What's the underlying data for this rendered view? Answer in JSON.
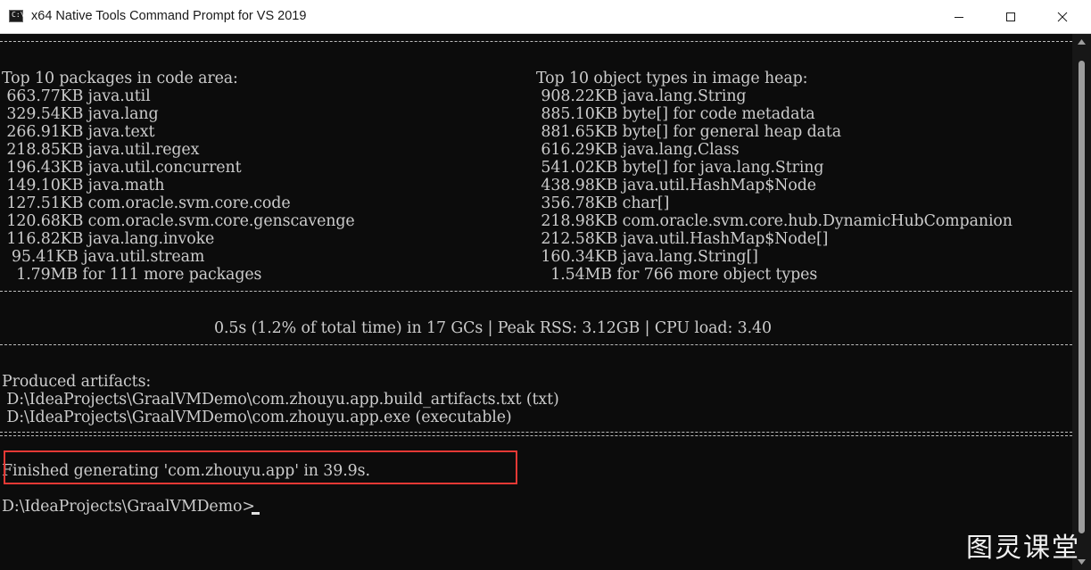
{
  "window": {
    "title": "x64 Native Tools Command Prompt for VS 2019",
    "icon": "cmd-icon",
    "controls": [
      "minimize-icon",
      "maximize-icon",
      "close-icon"
    ]
  },
  "terminal": {
    "left_header": "Top 10 packages in code area:",
    "right_header": "Top 10 object types in image heap:",
    "packages": [
      " 663.77KB java.util",
      " 329.54KB java.lang",
      " 266.91KB java.text",
      " 218.85KB java.util.regex",
      " 196.43KB java.util.concurrent",
      " 149.10KB java.math",
      " 127.51KB com.oracle.svm.core.code",
      " 120.68KB com.oracle.svm.core.genscavenge",
      " 116.82KB java.lang.invoke",
      "  95.41KB java.util.stream",
      "   1.79MB for 111 more packages"
    ],
    "object_types": [
      " 908.22KB java.lang.String",
      " 885.10KB byte[] for code metadata",
      " 881.65KB byte[] for general heap data",
      " 616.29KB java.lang.Class",
      " 541.02KB byte[] for java.lang.String",
      " 438.98KB java.util.HashMap$Node",
      " 356.78KB char[]",
      " 218.98KB com.oracle.svm.core.hub.DynamicHubCompanion",
      " 212.58KB java.util.HashMap$Node[]",
      " 160.34KB java.lang.String[]",
      "   1.54MB for 766 more object types"
    ],
    "gc_summary": "0.5s (1.2% of total time) in 17 GCs | Peak RSS: 3.12GB | CPU load: 3.40",
    "artifacts_header": "Produced artifacts:",
    "artifacts": [
      " D:\\IdeaProjects\\GraalVMDemo\\com.zhouyu.app.build_artifacts.txt (txt)",
      " D:\\IdeaProjects\\GraalVMDemo\\com.zhouyu.app.exe (executable)"
    ],
    "finished": "Finished generating 'com.zhouyu.app' in 39.9s.",
    "prompt": "D:\\IdeaProjects\\GraalVMDemo>"
  },
  "watermark": "图灵课堂",
  "colors": {
    "terminal_bg": "#0c0c0c",
    "terminal_fg": "#cccccc",
    "highlight": "#e53935"
  }
}
